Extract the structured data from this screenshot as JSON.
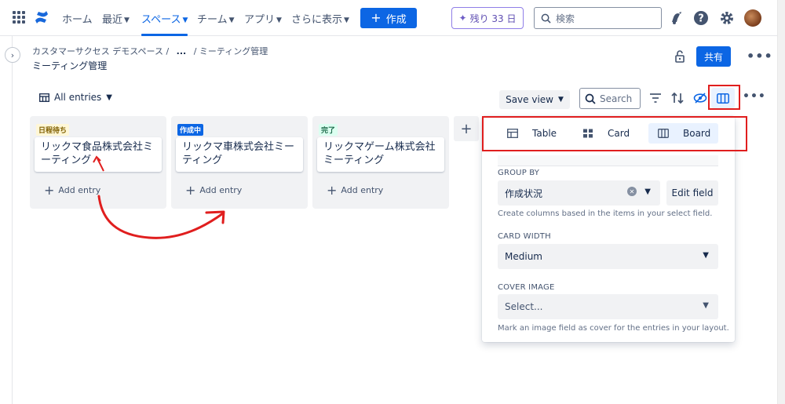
{
  "nav": {
    "items": [
      "ホーム",
      "最近",
      "スペース",
      "チーム",
      "アプリ",
      "さらに表示"
    ],
    "create_label": "作成",
    "trial_label": "残り 33 日",
    "search_placeholder": "検索"
  },
  "header": {
    "breadcrumb": [
      "カスタマーサクセス デモスペース",
      "...",
      "ミーティング管理"
    ],
    "title": "ミーティング管理",
    "share_label": "共有"
  },
  "toolbar": {
    "view_label": "All entries",
    "save_view_label": "Save view",
    "search_placeholder": "Search"
  },
  "board": {
    "columns": [
      {
        "label": "日程待ち",
        "label_bg": "#fff7d6",
        "label_color": "#7f5f01",
        "card": "リックマ食品株式会社ミーティング",
        "add_label": "Add entry"
      },
      {
        "label": "作成中",
        "label_bg": "#0c66e4",
        "label_color": "#ffffff",
        "card": "リックマ車株式会社ミーティング",
        "add_label": "Add entry"
      },
      {
        "label": "完了",
        "label_bg": "#dcfff1",
        "label_color": "#216e4e",
        "card": "リックマゲーム株式会社ミーティング",
        "add_label": "Add entry"
      }
    ],
    "add_column_label": "+"
  },
  "panel": {
    "layouts": [
      "Table",
      "Card",
      "Board"
    ],
    "selected_layout": "Board",
    "group_by_label": "GROUP BY",
    "group_by_value": "作成状況",
    "edit_field_label": "Edit field",
    "group_by_help": "Create columns based in the items in your select field.",
    "card_width_label": "CARD WIDTH",
    "card_width_value": "Medium",
    "cover_image_label": "COVER IMAGE",
    "cover_image_placeholder": "Select...",
    "cover_image_help": "Mark an image field as cover for the entries in your layout."
  },
  "colors": {
    "accent": "#0c66e4",
    "annotation": "#e01e1e"
  }
}
